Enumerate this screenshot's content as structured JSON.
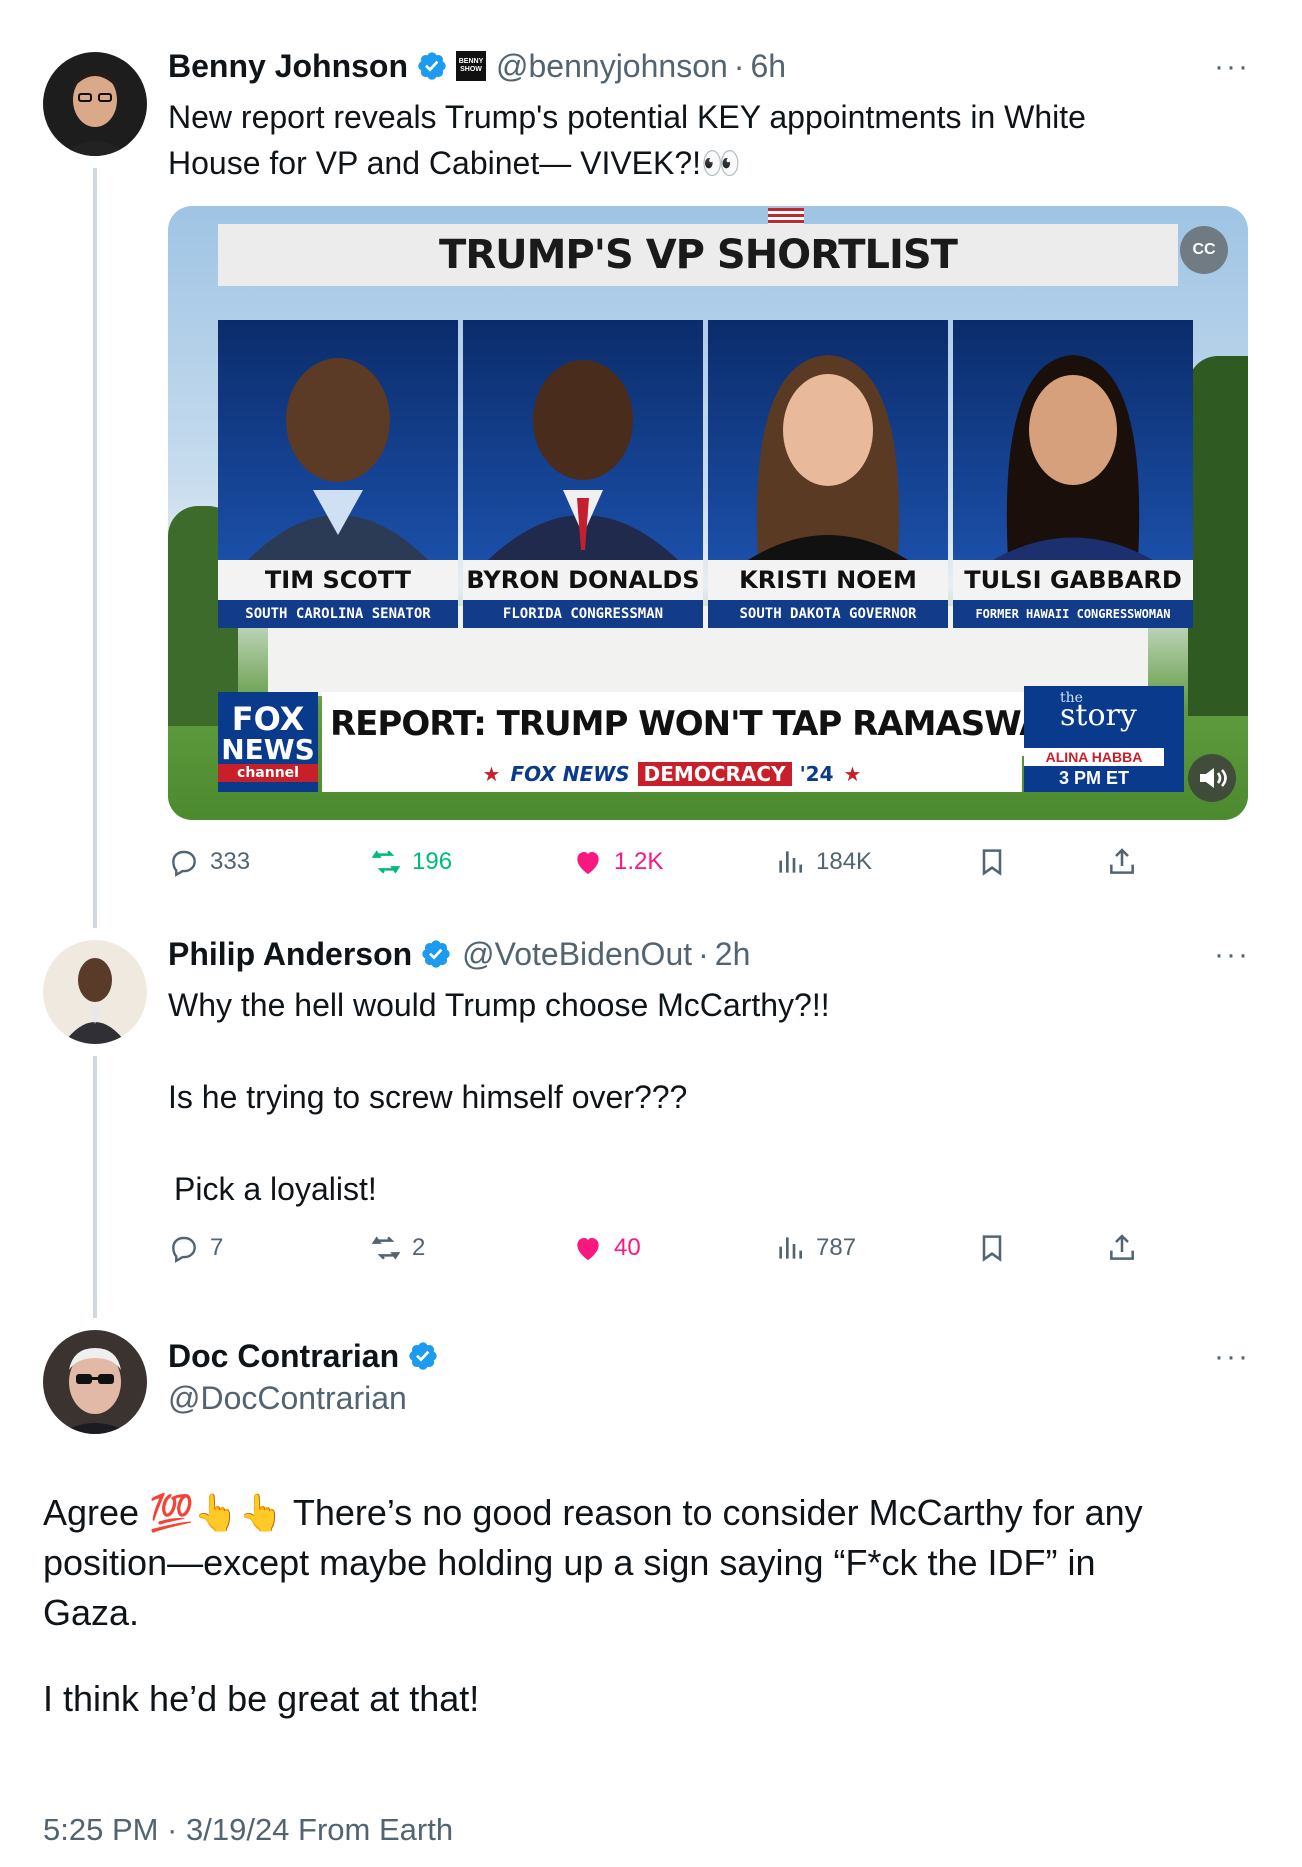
{
  "tweet1": {
    "name": "Benny Johnson",
    "handle": "@bennyjohnson",
    "time": "6h",
    "text_line1": "New report reveals Trump's potential KEY appointments in White",
    "text_line2": "House for VP and Cabinet— VIVEK?!👀",
    "badge_text": "BENNY SHOW",
    "media": {
      "banner": "TRUMP'S VP SHORTLIST",
      "candidates": [
        {
          "name": "TIM SCOTT",
          "title": "SOUTH CAROLINA SENATOR"
        },
        {
          "name": "BYRON DONALDS",
          "title": "FLORIDA CONGRESSMAN"
        },
        {
          "name": "KRISTI NOEM",
          "title": "SOUTH DAKOTA GOVERNOR"
        },
        {
          "name": "TULSI GABBARD",
          "title": "FORMER HAWAII CONGRESSWOMAN"
        }
      ],
      "logo_line1": "FOX",
      "logo_line2": "NEWS",
      "logo_line3": "channel",
      "headline": "REPORT: TRUMP WON'T TAP RAMASWAMY FOR VP",
      "subline_brand": "FOX NEWS",
      "subline_tag": "DEMOCRACY",
      "subline_year": "'24",
      "show_the": "the",
      "show_name": "story",
      "show_host": "ALINA HABBA",
      "show_time": "3 PM ET"
    },
    "stats": {
      "replies": "333",
      "reposts": "196",
      "likes": "1.2K",
      "views": "184K"
    }
  },
  "tweet2": {
    "name": "Philip Anderson",
    "handle": "@VoteBidenOut",
    "time": "2h",
    "line1": "Why the hell would Trump choose McCarthy?!!",
    "line2": "Is he trying to screw himself over???",
    "line3": "Pick a loyalist!",
    "stats": {
      "replies": "7",
      "reposts": "2",
      "likes": "40",
      "views": "787"
    }
  },
  "tweet3": {
    "name": "Doc Contrarian",
    "handle": "@DocContrarian",
    "body_line1": "Agree 💯👆👆 There’s no good reason to consider McCarthy for any",
    "body_line2": "position—except maybe holding up a sign saying “F*ck the IDF” in",
    "body_line3": "Gaza.",
    "body_line4": "I think he’d be great at that!",
    "timestamp": "5:25 PM · 3/19/24 From Earth"
  },
  "more_label": "···",
  "dot_separator": "·",
  "colors": {
    "verified": "#1d9bf0",
    "like": "#f91880",
    "repost": "#00ba7c",
    "meta": "#536471"
  }
}
